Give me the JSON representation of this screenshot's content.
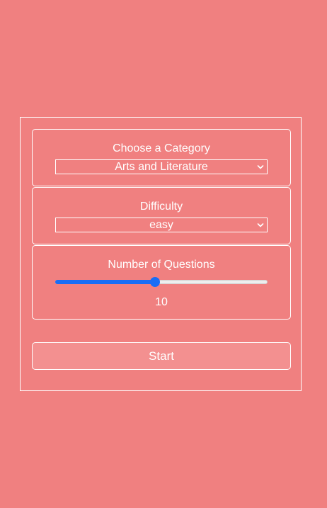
{
  "category": {
    "label": "Choose a Category",
    "selected": "Arts and Literature"
  },
  "difficulty": {
    "label": "Difficulty",
    "selected": "easy"
  },
  "questions": {
    "label": "Number of Questions",
    "value": "10",
    "slider_fraction": 0.47,
    "accent_color": "#1a6df5"
  },
  "start": {
    "label": "Start"
  },
  "colors": {
    "background": "#f08080",
    "border": "#ffffff",
    "button_bg": "#f39090"
  }
}
